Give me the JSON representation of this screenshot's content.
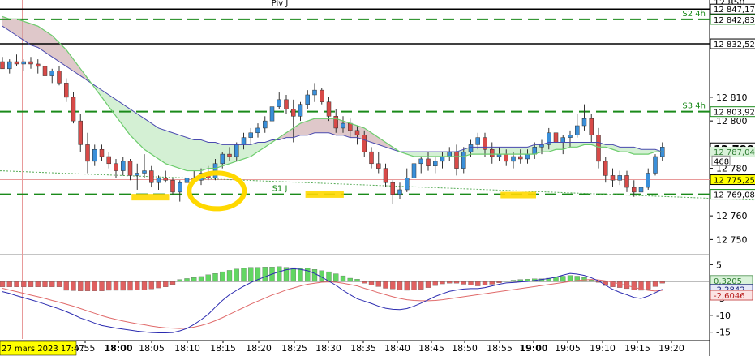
{
  "chart_data": {
    "type": "candlestick",
    "instrument_timeframe": "intraday",
    "price_axis": {
      "ylim": [
        12745,
        12851
      ],
      "tick_labels": [
        {
          "value": 12810,
          "label": "12 810"
        },
        {
          "value": 12800,
          "label": "12 800"
        },
        {
          "value": 12780,
          "label": "12 780"
        },
        {
          "value": 12760,
          "label": "12 760"
        },
        {
          "value": 12750,
          "label": "12 750"
        }
      ],
      "badges": [
        {
          "value": 12850,
          "label": "12 850",
          "kind": "plain"
        },
        {
          "value": 12847.17,
          "label": "12 847,17",
          "kind": "line-black"
        },
        {
          "value": 12842.83,
          "label": "12 842,83",
          "kind": "line-green"
        },
        {
          "value": 12832.52,
          "label": "12 832,52",
          "kind": "line-black"
        },
        {
          "value": 12803.92,
          "label": "12 803,92",
          "kind": "line-green"
        },
        {
          "value": 12788,
          "label": "12 788,",
          "kind": "current"
        },
        {
          "value": 12787.04,
          "label": "12 787,04",
          "kind": "ema"
        },
        {
          "value": 12783.2,
          "label": "468",
          "kind": "count"
        },
        {
          "value": 12775.25,
          "label": "12 775,25",
          "kind": "line-red"
        },
        {
          "value": 12769.08,
          "label": "12 769,08",
          "kind": "line-green"
        }
      ]
    },
    "levels": [
      {
        "name": "Piv J",
        "value": 12847.17,
        "style": "solid",
        "color": "#000000"
      },
      {
        "name": "S2 4h",
        "value": 12842.83,
        "style": "dashed",
        "color": "#1a8a1a"
      },
      {
        "name": "",
        "value": 12832.52,
        "style": "solid",
        "color": "#000000"
      },
      {
        "name": "S3 4h",
        "value": 12803.92,
        "style": "dashed",
        "color": "#1a8a1a"
      },
      {
        "name": "",
        "value": 12775.25,
        "style": "solid-thin",
        "color": "#e89a9a"
      },
      {
        "name": "S1 J",
        "value": 12769.08,
        "style": "dashed",
        "color": "#1a8a1a"
      }
    ],
    "time_axis": {
      "start_label": "27 mars 2023 17:47",
      "labels": [
        "7:55",
        "18:00",
        "18:05",
        "18:10",
        "18:15",
        "18:20",
        "18:25",
        "18:30",
        "18:35",
        "18:40",
        "18:45",
        "18:50",
        "18:55",
        "19:00",
        "19:05",
        "19:10",
        "19:15",
        "19:20"
      ],
      "bold_labels": [
        "18:00",
        "19:00"
      ]
    },
    "candles": [
      [
        12825,
        12827,
        12822,
        12822
      ],
      [
        12822,
        12826,
        12820,
        12825
      ],
      [
        12825,
        12828,
        12823,
        12824
      ],
      [
        12824,
        12826,
        12821,
        12825
      ],
      [
        12825,
        12827,
        12822,
        12824
      ],
      [
        12824,
        12826,
        12820,
        12823
      ],
      [
        12823,
        12824,
        12818,
        12819
      ],
      [
        12819,
        12822,
        12816,
        12821
      ],
      [
        12821,
        12823,
        12815,
        12816
      ],
      [
        12816,
        12818,
        12808,
        12810
      ],
      [
        12810,
        12812,
        12799,
        12800
      ],
      [
        12800,
        12803,
        12787,
        12790
      ],
      [
        12790,
        12795,
        12778,
        12783
      ],
      [
        12783,
        12790,
        12781,
        12788
      ],
      [
        12788,
        12790,
        12783,
        12785
      ],
      [
        12785,
        12787,
        12780,
        12782
      ],
      [
        12782,
        12784,
        12776,
        12779
      ],
      [
        12779,
        12785,
        12777,
        12783
      ],
      [
        12783,
        12784,
        12775,
        12777
      ],
      [
        12777,
        12782,
        12771,
        12778
      ],
      [
        12778,
        12786,
        12776,
        12779
      ],
      [
        12779,
        12781,
        12772,
        12774
      ],
      [
        12774,
        12777,
        12771,
        12776
      ],
      [
        12776,
        12779,
        12774,
        12775
      ],
      [
        12775,
        12776,
        12769,
        12770
      ],
      [
        12770,
        12775,
        12766,
        12774
      ],
      [
        12774,
        12778,
        12772,
        12776
      ],
      [
        12776,
        12779,
        12774,
        12775
      ],
      [
        12775,
        12780,
        12773,
        12778
      ],
      [
        12778,
        12781,
        12775,
        12776
      ],
      [
        12776,
        12784,
        12775,
        12782
      ],
      [
        12782,
        12787,
        12780,
        12786
      ],
      [
        12786,
        12789,
        12783,
        12785
      ],
      [
        12785,
        12791,
        12783,
        12790
      ],
      [
        12790,
        12795,
        12788,
        12793
      ],
      [
        12793,
        12797,
        12790,
        12795
      ],
      [
        12795,
        12799,
        12793,
        12797
      ],
      [
        12797,
        12802,
        12795,
        12800
      ],
      [
        12800,
        12807,
        12798,
        12806
      ],
      [
        12806,
        12812,
        12805,
        12809
      ],
      [
        12809,
        12811,
        12803,
        12805
      ],
      [
        12805,
        12809,
        12791,
        12802
      ],
      [
        12802,
        12808,
        12800,
        12807
      ],
      [
        12807,
        12813,
        12805,
        12811
      ],
      [
        12811,
        12816,
        12808,
        12813
      ],
      [
        12813,
        12814,
        12807,
        12808
      ],
      [
        12808,
        12810,
        12800,
        12802
      ],
      [
        12802,
        12805,
        12795,
        12797
      ],
      [
        12797,
        12802,
        12795,
        12799
      ],
      [
        12799,
        12801,
        12793,
        12796
      ],
      [
        12796,
        12798,
        12790,
        12794
      ],
      [
        12794,
        12796,
        12785,
        12787
      ],
      [
        12787,
        12789,
        12780,
        12782
      ],
      [
        12782,
        12787,
        12778,
        12780
      ],
      [
        12780,
        12782,
        12772,
        12774
      ],
      [
        12774,
        12775,
        12765,
        12769
      ],
      [
        12769,
        12774,
        12767,
        12771
      ],
      [
        12771,
        12780,
        12770,
        12776
      ],
      [
        12776,
        12784,
        12774,
        12782
      ],
      [
        12782,
        12785,
        12778,
        12784
      ],
      [
        12784,
        12787,
        12779,
        12781
      ],
      [
        12781,
        12785,
        12778,
        12783
      ],
      [
        12783,
        12787,
        12780,
        12785
      ],
      [
        12785,
        12789,
        12783,
        12787
      ],
      [
        12787,
        12790,
        12777,
        12780
      ],
      [
        12780,
        12789,
        12778,
        12787
      ],
      [
        12787,
        12792,
        12785,
        12790
      ],
      [
        12790,
        12795,
        12788,
        12793
      ],
      [
        12793,
        12795,
        12785,
        12788
      ],
      [
        12788,
        12791,
        12782,
        12785
      ],
      [
        12785,
        12789,
        12783,
        12786
      ],
      [
        12786,
        12788,
        12781,
        12783
      ],
      [
        12783,
        12787,
        12780,
        12785
      ],
      [
        12785,
        12788,
        12782,
        12784
      ],
      [
        12784,
        12788,
        12782,
        12786
      ],
      [
        12786,
        12791,
        12784,
        12789
      ],
      [
        12789,
        12792,
        12786,
        12790
      ],
      [
        12790,
        12797,
        12788,
        12795
      ],
      [
        12795,
        12799,
        12789,
        12791
      ],
      [
        12791,
        12794,
        12786,
        12793
      ],
      [
        12793,
        12796,
        12789,
        12794
      ],
      [
        12794,
        12803,
        12793,
        12798
      ],
      [
        12798,
        12807,
        12796,
        12801
      ],
      [
        12801,
        12803,
        12791,
        12794
      ],
      [
        12794,
        12797,
        12780,
        12783
      ],
      [
        12783,
        12785,
        12774,
        12777
      ],
      [
        12777,
        12780,
        12772,
        12775
      ],
      [
        12775,
        12779,
        12773,
        12777
      ],
      [
        12777,
        12779,
        12770,
        12772
      ],
      [
        12772,
        12775,
        12768,
        12770
      ],
      [
        12770,
        12773,
        12767,
        12772
      ],
      [
        12772,
        12780,
        12771,
        12778
      ],
      [
        12778,
        12786,
        12777,
        12785
      ],
      [
        12785,
        12791,
        12783,
        12789
      ]
    ],
    "ema_fast": [
      12840,
      12838,
      12836,
      12834,
      12832,
      12831,
      12829,
      12827,
      12825,
      12823,
      12821,
      12819,
      12817,
      12815,
      12813,
      12811,
      12809,
      12807,
      12805,
      12803,
      12801,
      12799,
      12797,
      12796,
      12795,
      12794,
      12793,
      12792,
      12792,
      12791,
      12791,
      12790,
      12790,
      12790,
      12790,
      12790,
      12791,
      12791,
      12792,
      12792,
      12793,
      12793,
      12794,
      12794,
      12795,
      12795,
      12795,
      12794,
      12794,
      12793,
      12793,
      12792,
      12791,
      12790,
      12789,
      12788,
      12787,
      12787,
      12787,
      12787,
      12787,
      12787,
      12787,
      12787,
      12787,
      12788,
      12789,
      12789,
      12789,
      12789,
      12789,
      12789,
      12789,
      12789,
      12789,
      12790,
      12790,
      12791,
      12791,
      12791,
      12791,
      12791,
      12791,
      12791,
      12791,
      12790,
      12790,
      12789,
      12789,
      12789,
      12788,
      12788,
      12788,
      12787
    ],
    "ema_slow": [
      12844,
      12843,
      12843,
      12842,
      12841,
      12840,
      12838,
      12836,
      12833,
      12830,
      12826,
      12822,
      12818,
      12814,
      12810,
      12806,
      12802,
      12798,
      12794,
      12791,
      12788,
      12786,
      12784,
      12782,
      12781,
      12780,
      12779,
      12779,
      12779,
      12780,
      12780,
      12781,
      12782,
      12783,
      12784,
      12785,
      12787,
      12789,
      12791,
      12793,
      12795,
      12797,
      12799,
      12800,
      12801,
      12801,
      12801,
      12801,
      12800,
      12799,
      12798,
      12797,
      12795,
      12793,
      12791,
      12789,
      12787,
      12786,
      12785,
      12785,
      12785,
      12785,
      12785,
      12785,
      12785,
      12785,
      12786,
      12786,
      12786,
      12786,
      12786,
      12786,
      12786,
      12786,
      12786,
      12786,
      12787,
      12787,
      12788,
      12788,
      12789,
      12789,
      12790,
      12790,
      12789,
      12789,
      12788,
      12787,
      12787,
      12786,
      12786,
      12786,
      12787,
      12787
    ],
    "trendline": {
      "from": [
        0,
        12779
      ],
      "to": [
        1.12,
        12766
      ],
      "style": "dotted",
      "color": "#55aa55"
    },
    "annotations": [
      {
        "type": "underline",
        "x": [
          18.2,
          23.6
        ],
        "value": 12768.2,
        "color": "#ffd800"
      },
      {
        "type": "circle",
        "cx": 30.2,
        "value": 12770.5,
        "color": "#ffd800"
      },
      {
        "type": "underline",
        "x": [
          42.7,
          48.1
        ],
        "value": 12769.3,
        "color": "#ffd800"
      },
      {
        "type": "underline",
        "x": [
          70.2,
          75.2
        ],
        "value": 12769.1,
        "color": "#ffd800"
      }
    ],
    "current_time_index": 2.8,
    "macd_panel": {
      "ylim": [
        -17,
        7
      ],
      "tick_labels": [
        {
          "value": 5,
          "label": "5"
        },
        {
          "value": -5,
          "label": "-5"
        },
        {
          "value": -10,
          "label": "-10"
        },
        {
          "value": -15,
          "label": "-15"
        }
      ],
      "badges": [
        {
          "value": 0.3205,
          "label": "0,3205",
          "color": "#2e7d32",
          "bg": "#d9f2d9"
        },
        {
          "value": -2.28,
          "label": "-2,2842",
          "color": "#1a237e",
          "bg": "#e6e8f7"
        },
        {
          "value": -2.6046,
          "label": "-2,6046",
          "color": "#b71c1c",
          "bg": "#fbe3e3"
        }
      ],
      "histogram": [
        -1.6,
        -1.6,
        -1.6,
        -1.6,
        -1.6,
        -1.6,
        -1.6,
        -1.6,
        -1.6,
        -2.6,
        -2.7,
        -2.8,
        -2.8,
        -2.8,
        -2.8,
        -2.6,
        -2.6,
        -2.6,
        -2.6,
        -2.5,
        -2.4,
        -2.2,
        -1.9,
        -1.6,
        -0.9,
        0.6,
        0.9,
        1.2,
        1.5,
        2.0,
        2.4,
        2.9,
        3.3,
        3.7,
        3.9,
        4.2,
        4.2,
        4.3,
        4.3,
        4.4,
        4.2,
        4.1,
        4.0,
        3.9,
        3.6,
        3.2,
        2.9,
        2.3,
        1.7,
        1.0,
        0.7,
        -0.5,
        -1.0,
        -1.5,
        -2.0,
        -2.2,
        -2.4,
        -2.6,
        -2.5,
        -2.3,
        -1.8,
        -1.2,
        -0.7,
        -0.5,
        -0.5,
        -0.8,
        -1.0,
        -1.3,
        -1.1,
        -0.8,
        -0.4,
        0.2,
        0.4,
        0.6,
        0.7,
        0.8,
        0.8,
        1.0,
        1.3,
        1.6,
        1.8,
        1.6,
        1.2,
        0.5,
        -0.2,
        -1.2,
        -1.6,
        -1.8,
        -2.1,
        -2.4,
        -2.6,
        -2.3,
        -1.5,
        -0.5
      ],
      "macd_line": [
        -3.0,
        -3.5,
        -4.2,
        -4.8,
        -5.4,
        -6.0,
        -6.7,
        -7.4,
        -8.1,
        -8.9,
        -9.8,
        -10.8,
        -11.5,
        -12.3,
        -13.0,
        -13.4,
        -13.8,
        -14.1,
        -14.4,
        -14.7,
        -14.9,
        -15.1,
        -15.2,
        -15.2,
        -15.1,
        -14.6,
        -13.9,
        -12.7,
        -11.3,
        -9.7,
        -7.6,
        -5.6,
        -3.9,
        -2.6,
        -1.4,
        -0.3,
        0.6,
        1.4,
        2.2,
        2.9,
        3.5,
        3.8,
        3.6,
        3.2,
        2.4,
        1.3,
        0.1,
        -1.1,
        -2.6,
        -3.9,
        -5.1,
        -5.8,
        -6.5,
        -7.3,
        -7.9,
        -8.2,
        -8.3,
        -8.0,
        -7.3,
        -6.4,
        -5.4,
        -4.4,
        -3.6,
        -2.9,
        -2.5,
        -2.2,
        -2.1,
        -2.1,
        -1.8,
        -1.3,
        -0.8,
        -0.4,
        -0.3,
        -0.1,
        0.0,
        0.3,
        0.6,
        0.9,
        1.3,
        1.9,
        2.4,
        2.2,
        1.8,
        1.1,
        0.2,
        -1.1,
        -2.3,
        -3.2,
        -3.9,
        -4.7,
        -5.0,
        -4.3,
        -3.3,
        -2.3
      ],
      "signal_line": [
        -2.0,
        -2.5,
        -3.0,
        -3.5,
        -4.0,
        -4.5,
        -5.0,
        -5.6,
        -6.1,
        -6.7,
        -7.3,
        -8.0,
        -8.7,
        -9.4,
        -10.1,
        -10.7,
        -11.2,
        -11.7,
        -12.1,
        -12.5,
        -12.8,
        -13.2,
        -13.5,
        -13.7,
        -13.8,
        -13.9,
        -13.8,
        -13.5,
        -13.0,
        -12.4,
        -11.6,
        -10.7,
        -9.7,
        -8.7,
        -7.7,
        -6.7,
        -5.8,
        -4.9,
        -4.0,
        -3.3,
        -2.5,
        -1.9,
        -1.3,
        -0.8,
        -0.5,
        -0.2,
        -0.1,
        -0.2,
        -0.5,
        -0.9,
        -1.3,
        -2.0,
        -2.6,
        -3.3,
        -3.9,
        -4.5,
        -5.0,
        -5.4,
        -5.6,
        -5.7,
        -5.7,
        -5.6,
        -5.4,
        -5.1,
        -4.8,
        -4.5,
        -4.2,
        -3.9,
        -3.6,
        -3.3,
        -3.0,
        -2.7,
        -2.4,
        -2.1,
        -1.8,
        -1.5,
        -1.2,
        -0.9,
        -0.6,
        -0.3,
        0.0,
        0.3,
        0.5,
        0.6,
        0.5,
        0.2,
        -0.2,
        -0.7,
        -1.2,
        -1.7,
        -2.2,
        -2.6,
        -2.8,
        -2.6
      ]
    },
    "colors": {
      "bull": "#3a8fd9",
      "bear": "#d84a48",
      "wick": "#333333",
      "ema_fast": "#4a4ab0",
      "ema_slow": "#6ccc6c",
      "cloud_bear": "#c9a3a6",
      "cloud_bull": "#b8e6b8",
      "macd_pos": "#62d662",
      "macd_neg": "#e06060",
      "macd_line": "#2b2bb0",
      "signal_line": "#e06a6a",
      "grid_dash": "#1f8a1f",
      "vline": "#e89a9a",
      "highlight": "#ffd800"
    }
  }
}
